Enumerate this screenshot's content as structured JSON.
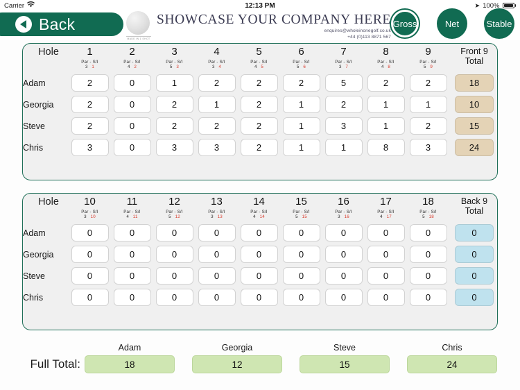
{
  "statusbar": {
    "carrier": "Carrier",
    "wifi_icon": "wifi-icon",
    "time": "12:13 PM",
    "location_icon": "location-arrow-icon",
    "battery_pct": "100%",
    "battery_icon": "battery-full-icon"
  },
  "header": {
    "back_label": "Back",
    "back_icon": "chevron-left-icon",
    "logo_icon": "golf-ball-icon",
    "logo_ball_tag": "MADE IN 1 SHOT",
    "company_name": "SHOWCASE YOUR COMPANY HERE",
    "company_email": "enquires@wholeinonegolf.co.uk",
    "company_phone": "+44 (0)113 8871 567",
    "modes": [
      {
        "label": "Gross",
        "selected": true
      },
      {
        "label": "Net",
        "selected": false
      },
      {
        "label": "Stable",
        "selected": false
      }
    ]
  },
  "labels": {
    "hole": "Hole",
    "par": "Par",
    "dash": "-",
    "si": "S/I",
    "front_total": "Front 9\nTotal",
    "front_total_line1": "Front 9",
    "front_total_line2": "Total",
    "back_total_line1": "Back 9",
    "back_total_line2": "Total",
    "full_total": "Full Total:"
  },
  "colors": {
    "brand_green": "#116b52",
    "card_border": "#1f6f58",
    "si_red": "#d93a2b",
    "total_tan": "#e4d3b6",
    "total_blue": "#bfe2ee",
    "full_total_green": "#cfe6b2"
  },
  "front_nine": {
    "holes": [
      "1",
      "2",
      "3",
      "4",
      "5",
      "6",
      "7",
      "8",
      "9"
    ],
    "pars": [
      "3",
      "4",
      "5",
      "3",
      "4",
      "5",
      "3",
      "4",
      "5"
    ],
    "si": [
      "1",
      "2",
      "3",
      "4",
      "5",
      "6",
      "7",
      "8",
      "9"
    ],
    "rows": [
      {
        "player": "Adam",
        "scores": [
          "2",
          "0",
          "1",
          "2",
          "2",
          "2",
          "5",
          "2",
          "2"
        ],
        "total": "18"
      },
      {
        "player": "Georgia",
        "scores": [
          "2",
          "0",
          "2",
          "1",
          "2",
          "1",
          "2",
          "1",
          "1"
        ],
        "total": "10"
      },
      {
        "player": "Steve",
        "scores": [
          "2",
          "0",
          "2",
          "2",
          "2",
          "1",
          "3",
          "1",
          "2"
        ],
        "total": "15"
      },
      {
        "player": "Chris",
        "scores": [
          "3",
          "0",
          "3",
          "3",
          "2",
          "1",
          "1",
          "8",
          "3"
        ],
        "total": "24"
      }
    ]
  },
  "back_nine": {
    "holes": [
      "10",
      "11",
      "12",
      "13",
      "14",
      "15",
      "16",
      "17",
      "18"
    ],
    "pars": [
      "3",
      "4",
      "5",
      "3",
      "4",
      "5",
      "3",
      "4",
      "5"
    ],
    "si": [
      "10",
      "11",
      "12",
      "13",
      "14",
      "15",
      "16",
      "17",
      "18"
    ],
    "rows": [
      {
        "player": "Adam",
        "scores": [
          "0",
          "0",
          "0",
          "0",
          "0",
          "0",
          "0",
          "0",
          "0"
        ],
        "total": "0"
      },
      {
        "player": "Georgia",
        "scores": [
          "0",
          "0",
          "0",
          "0",
          "0",
          "0",
          "0",
          "0",
          "0"
        ],
        "total": "0"
      },
      {
        "player": "Steve",
        "scores": [
          "0",
          "0",
          "0",
          "0",
          "0",
          "0",
          "0",
          "0",
          "0"
        ],
        "total": "0"
      },
      {
        "player": "Chris",
        "scores": [
          "0",
          "0",
          "0",
          "0",
          "0",
          "0",
          "0",
          "0",
          "0"
        ],
        "total": "0"
      }
    ]
  },
  "footer": {
    "players": [
      "Adam",
      "Georgia",
      "Steve",
      "Chris"
    ],
    "totals": [
      "18",
      "12",
      "15",
      "24"
    ]
  }
}
